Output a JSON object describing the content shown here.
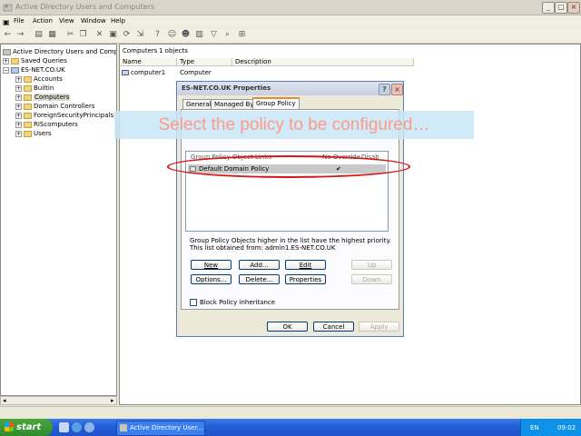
{
  "window": {
    "title": "Active Directory Users and Computers"
  },
  "menu": [
    "File",
    "Action",
    "View",
    "Window",
    "Help"
  ],
  "tree": {
    "root": "Active Directory Users and Computers",
    "saved_queries": "Saved Queries",
    "domain": "ES-NET.CO.UK",
    "items": [
      "Accounts",
      "Builtin",
      "Computers",
      "Domain Controllers",
      "ForeignSecurityPrincipals",
      "RIScomputers",
      "Users"
    ]
  },
  "right_pane": {
    "container": "Computers",
    "count": "1 objects",
    "columns": [
      "Name",
      "Type",
      "Description"
    ],
    "rows": [
      {
        "name": "computer1",
        "type": "Computer",
        "description": ""
      }
    ]
  },
  "dialog": {
    "title": "ES-NET.CO.UK Properties",
    "tabs": [
      "General",
      "Managed By",
      "Group Policy"
    ],
    "list_headers": [
      "Group Policy Object Links",
      "No Override",
      "Disab"
    ],
    "links": [
      {
        "name": "Default Domain Policy",
        "no_override": "✔",
        "disabled": ""
      }
    ],
    "note_line1": "Group Policy Objects higher in the list have the highest priority.",
    "note_line2": "This list obtained from: admin1.ES-NET.CO.UK",
    "buttons": {
      "new": "New",
      "add": "Add...",
      "edit": "Edit",
      "up": "Up",
      "options": "Options...",
      "delete": "Delete...",
      "properties": "Properties",
      "down": "Down"
    },
    "block_inheritance": "Block Policy inheritance",
    "ok": "OK",
    "cancel": "Cancel",
    "apply": "Apply"
  },
  "annotation": "Select the policy to be configured…",
  "taskbar": {
    "start": "start",
    "task": "Active Directory User...",
    "lang": "EN",
    "clock": "09:02"
  },
  "colors": {
    "highlight_ring": "#d81515",
    "overlay_text": "#ff9a8a",
    "tab_accent": "#e68b2c"
  }
}
